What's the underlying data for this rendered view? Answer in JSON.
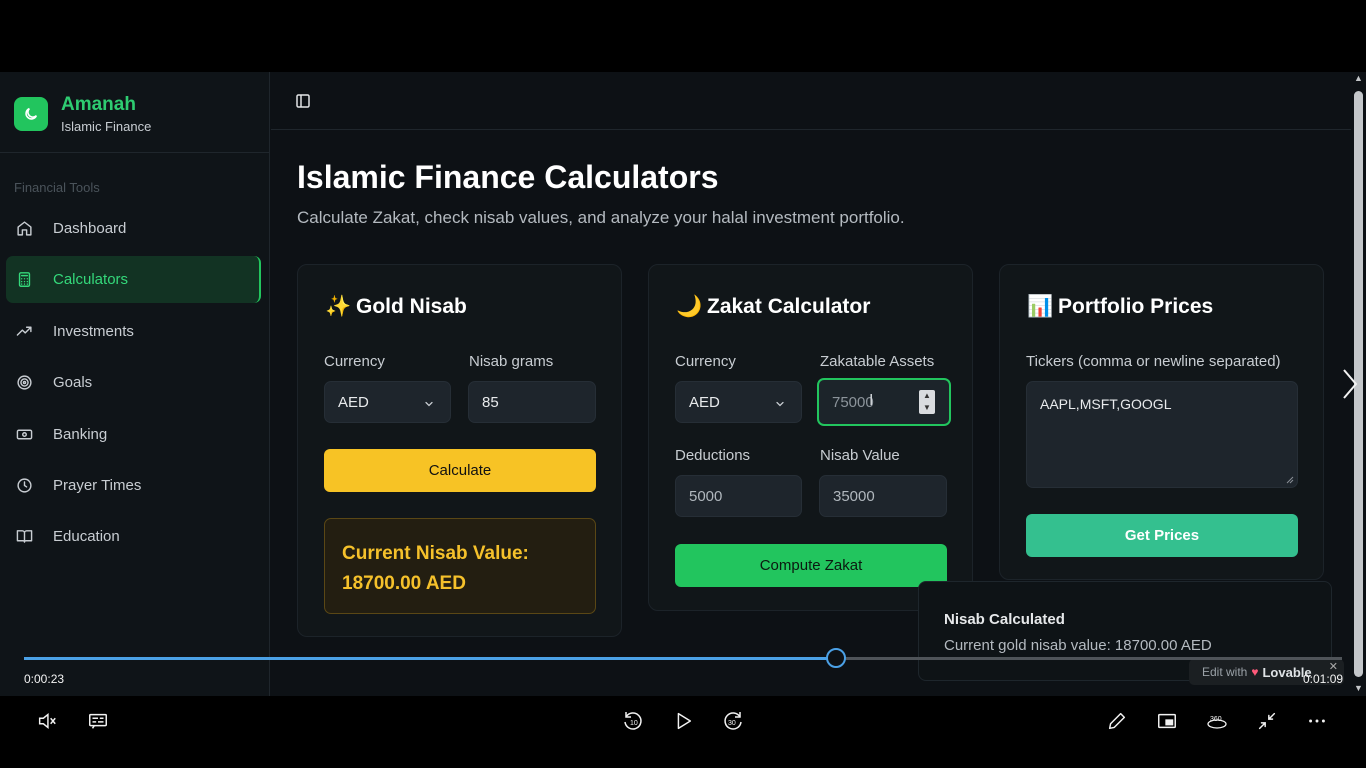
{
  "brand": {
    "name": "Amanah",
    "subtitle": "Islamic Finance"
  },
  "sidebar": {
    "section_label": "Financial Tools",
    "items": [
      {
        "label": "Dashboard",
        "icon": "home-icon"
      },
      {
        "label": "Calculators",
        "icon": "calculator-icon",
        "active": true
      },
      {
        "label": "Investments",
        "icon": "trending-up-icon"
      },
      {
        "label": "Goals",
        "icon": "target-icon"
      },
      {
        "label": "Banking",
        "icon": "banknote-icon"
      },
      {
        "label": "Prayer Times",
        "icon": "clock-icon"
      },
      {
        "label": "Education",
        "icon": "book-icon"
      }
    ]
  },
  "main": {
    "title": "Islamic Finance Calculators",
    "subtitle": "Calculate Zakat, check nisab values, and analyze your halal investment portfolio."
  },
  "gold_nisab": {
    "emoji": "✨",
    "title": "Gold Nisab",
    "currency_label": "Currency",
    "currency_value": "AED",
    "grams_label": "Nisab grams",
    "grams_value": "85",
    "button": "Calculate",
    "result_label": "Current Nisab Value:",
    "result_value": "18700.00 AED"
  },
  "zakat": {
    "emoji": "🌙",
    "title": "Zakat Calculator",
    "currency_label": "Currency",
    "currency_value": "AED",
    "assets_label": "Zakatable Assets",
    "assets_value": "75000",
    "deductions_label": "Deductions",
    "deductions_value": "5000",
    "nisab_label": "Nisab Value",
    "nisab_value": "35000",
    "button": "Compute Zakat"
  },
  "portfolio": {
    "emoji": "📊",
    "title": "Portfolio Prices",
    "tickers_label": "Tickers (comma or newline separated)",
    "tickers_value": "AAPL,MSFT,GOOGL",
    "button": "Get Prices"
  },
  "toast": {
    "title": "Nisab Calculated",
    "description": "Current gold nisab value: 18700.00 AED"
  },
  "badge": {
    "prefix": "Edit with",
    "brand": "Lovable",
    "close": "✕"
  },
  "player": {
    "current_time": "0:00:23",
    "total_time": "0:01:09",
    "progress_fraction": 0.616
  },
  "colors": {
    "accent": "#22c55e",
    "gold": "#f7c325",
    "teal": "#34c08f",
    "background": "#0d1115"
  }
}
